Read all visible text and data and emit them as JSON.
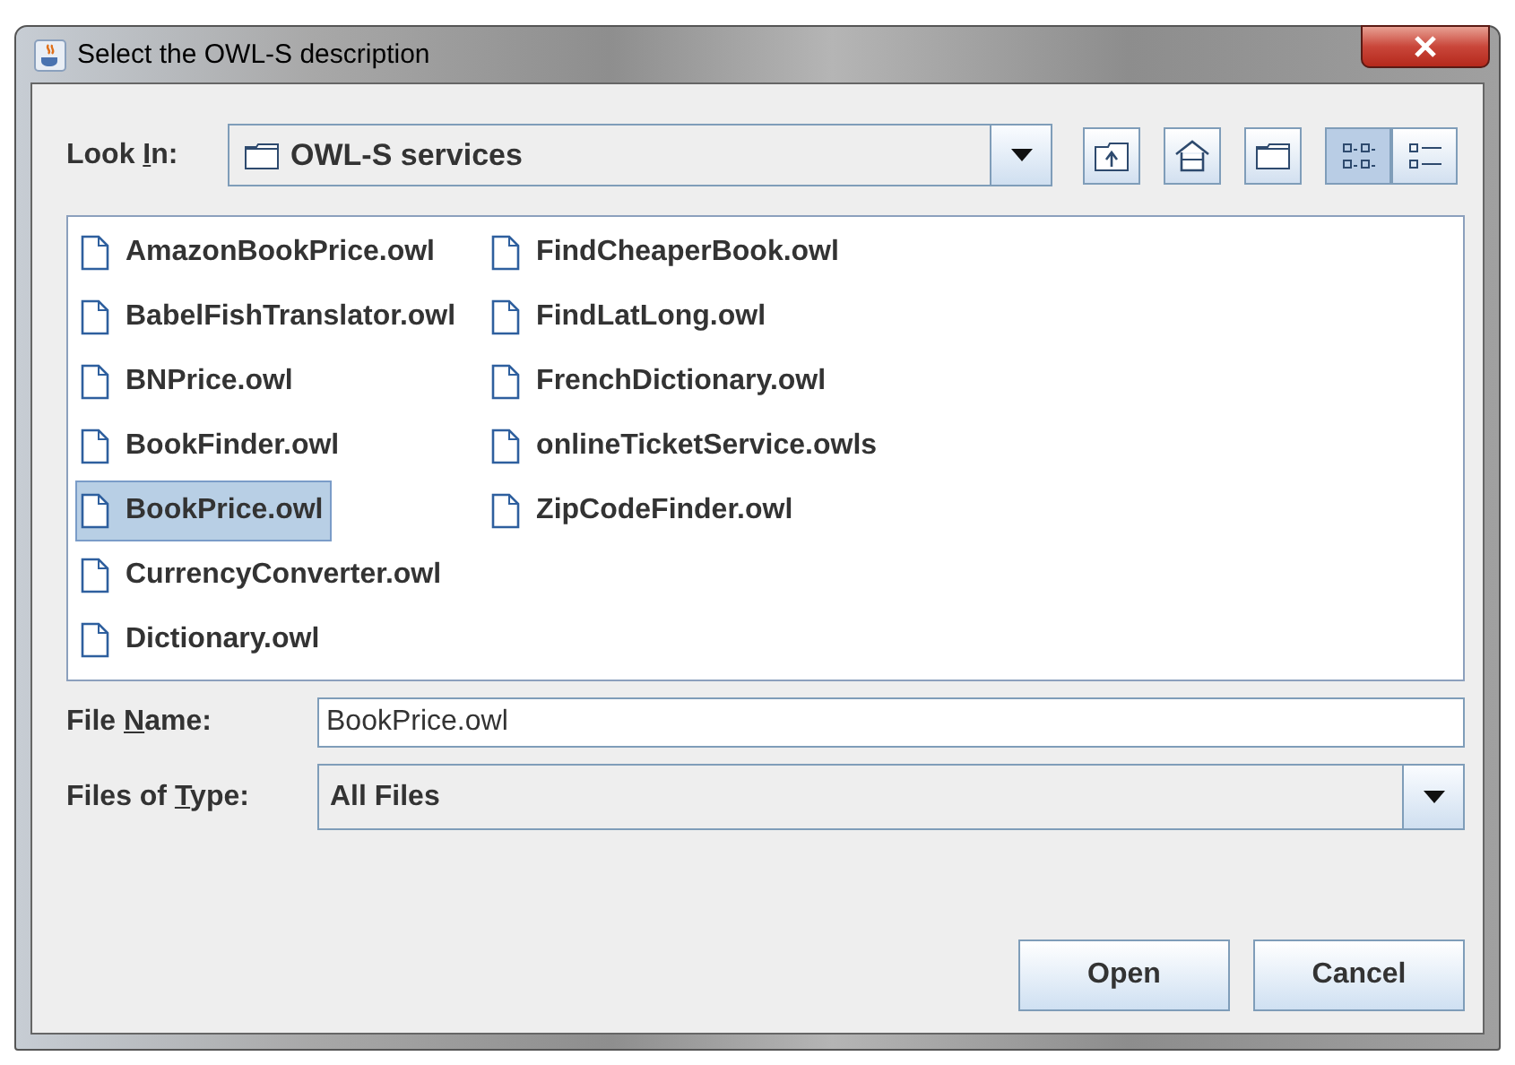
{
  "window": {
    "title": "Select the OWL-S description"
  },
  "look_in": {
    "label": {
      "before": "Look ",
      "key": "I",
      "after": "n:"
    },
    "value": "OWL-S services"
  },
  "toolbar": [
    {
      "kind": "up"
    },
    {
      "kind": "home"
    },
    {
      "kind": "new-folder"
    },
    {
      "kind": "list-view",
      "selected": true
    },
    {
      "kind": "details-view",
      "selected": false
    }
  ],
  "files": [
    {
      "name": "AmazonBookPrice.owl",
      "selected": false
    },
    {
      "name": "BabelFishTranslator.owl",
      "selected": false
    },
    {
      "name": "BNPrice.owl",
      "selected": false
    },
    {
      "name": "BookFinder.owl",
      "selected": false
    },
    {
      "name": "BookPrice.owl",
      "selected": true
    },
    {
      "name": "CurrencyConverter.owl",
      "selected": false
    },
    {
      "name": "Dictionary.owl",
      "selected": false
    },
    {
      "name": "FindCheaperBook.owl",
      "selected": false
    },
    {
      "name": "FindLatLong.owl",
      "selected": false
    },
    {
      "name": "FrenchDictionary.owl",
      "selected": false
    },
    {
      "name": "onlineTicketService.owls",
      "selected": false
    },
    {
      "name": "ZipCodeFinder.owl",
      "selected": false
    }
  ],
  "file_name": {
    "label": {
      "before": "File ",
      "key": "N",
      "after": "ame:"
    },
    "value": "BookPrice.owl"
  },
  "file_type": {
    "label": {
      "before": "Files of ",
      "key": "T",
      "after": "ype:"
    },
    "value": "All Files"
  },
  "buttons": [
    "Open",
    "Cancel"
  ]
}
